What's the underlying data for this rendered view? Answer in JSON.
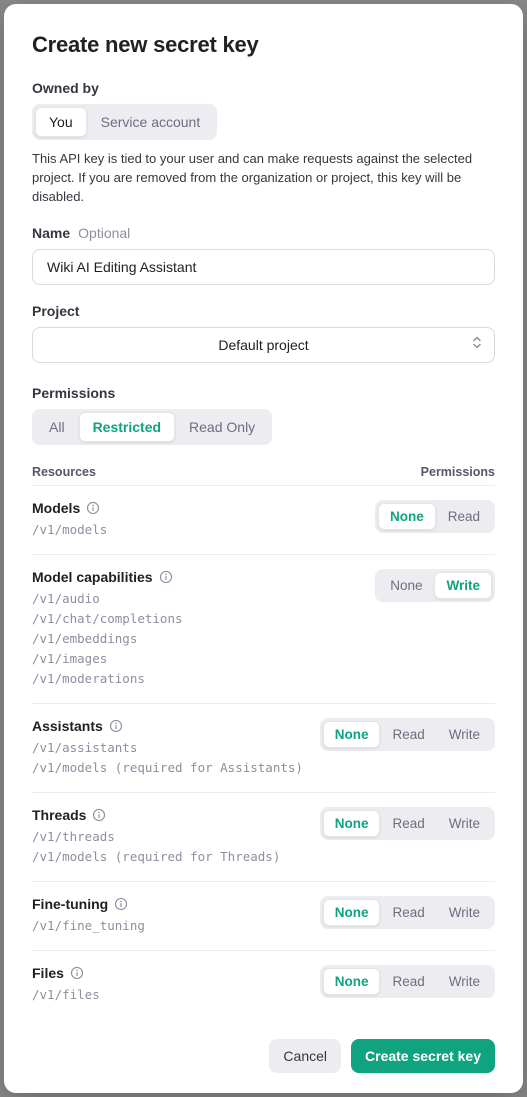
{
  "modal": {
    "title": "Create new secret key",
    "owned_by": {
      "label": "Owned by",
      "options": [
        "You",
        "Service account"
      ],
      "selected": "You",
      "help": "This API key is tied to your user and can make requests against the selected project. If you are removed from the organization or project, this key will be disabled."
    },
    "name": {
      "label": "Name",
      "optional": "Optional",
      "value": "Wiki AI Editing Assistant"
    },
    "project": {
      "label": "Project",
      "value": "Default project"
    },
    "permissions": {
      "label": "Permissions",
      "modes": [
        "All",
        "Restricted",
        "Read Only"
      ],
      "selected": "Restricted",
      "heading_resources": "Resources",
      "heading_permissions": "Permissions",
      "levels": {
        "none": "None",
        "read": "Read",
        "write": "Write"
      },
      "rows": [
        {
          "title": "Models",
          "paths": [
            "/v1/models"
          ],
          "options": [
            "None",
            "Read"
          ],
          "selected": "None"
        },
        {
          "title": "Model capabilities",
          "paths": [
            "/v1/audio",
            "/v1/chat/completions",
            "/v1/embeddings",
            "/v1/images",
            "/v1/moderations"
          ],
          "options": [
            "None",
            "Write"
          ],
          "selected": "Write"
        },
        {
          "title": "Assistants",
          "paths": [
            "/v1/assistants",
            "/v1/models (required for Assistants)"
          ],
          "options": [
            "None",
            "Read",
            "Write"
          ],
          "selected": "None"
        },
        {
          "title": "Threads",
          "paths": [
            "/v1/threads",
            "/v1/models (required for Threads)"
          ],
          "options": [
            "None",
            "Read",
            "Write"
          ],
          "selected": "None"
        },
        {
          "title": "Fine-tuning",
          "paths": [
            "/v1/fine_tuning"
          ],
          "options": [
            "None",
            "Read",
            "Write"
          ],
          "selected": "None"
        },
        {
          "title": "Files",
          "paths": [
            "/v1/files"
          ],
          "options": [
            "None",
            "Read",
            "Write"
          ],
          "selected": "None"
        }
      ]
    },
    "footer": {
      "cancel": "Cancel",
      "create": "Create secret key"
    }
  }
}
